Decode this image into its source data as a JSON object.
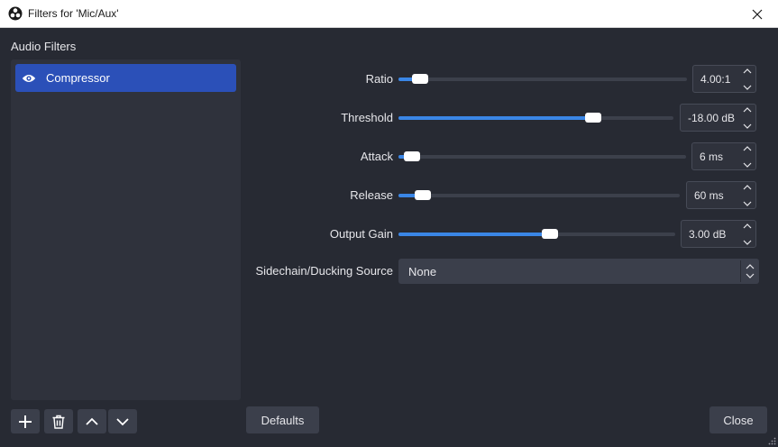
{
  "window": {
    "title": "Filters for 'Mic/Aux'"
  },
  "filters": {
    "section_label": "Audio Filters",
    "items": [
      {
        "label": "Compressor",
        "visible": true,
        "selected": true
      }
    ]
  },
  "list_buttons": [
    {
      "name": "add-filter-button",
      "icon": "plus-icon"
    },
    {
      "name": "remove-filter-button",
      "icon": "trash-icon"
    },
    {
      "name": "move-up-button",
      "icon": "chevron-up-icon"
    },
    {
      "name": "move-down-button",
      "icon": "chevron-down-icon"
    }
  ],
  "properties": {
    "ratio": {
      "label": "Ratio",
      "value": "4.00:1",
      "level": 0.07
    },
    "threshold": {
      "label": "Threshold",
      "value": "-18.00 dB",
      "level": 0.7
    },
    "attack": {
      "label": "Attack",
      "value": "6 ms",
      "level": 0.04
    },
    "release": {
      "label": "Release",
      "value": "60 ms",
      "level": 0.08
    },
    "output_gain": {
      "label": "Output Gain",
      "value": "3.00 dB",
      "level": 0.54
    },
    "sidechain": {
      "label": "Sidechain/Ducking Source",
      "value": "None"
    }
  },
  "buttons": {
    "defaults": "Defaults",
    "close": "Close"
  },
  "colors": {
    "accent": "#3a86e6",
    "selection": "#2b50b8",
    "background": "#272a33",
    "panel": "#2f323c"
  }
}
